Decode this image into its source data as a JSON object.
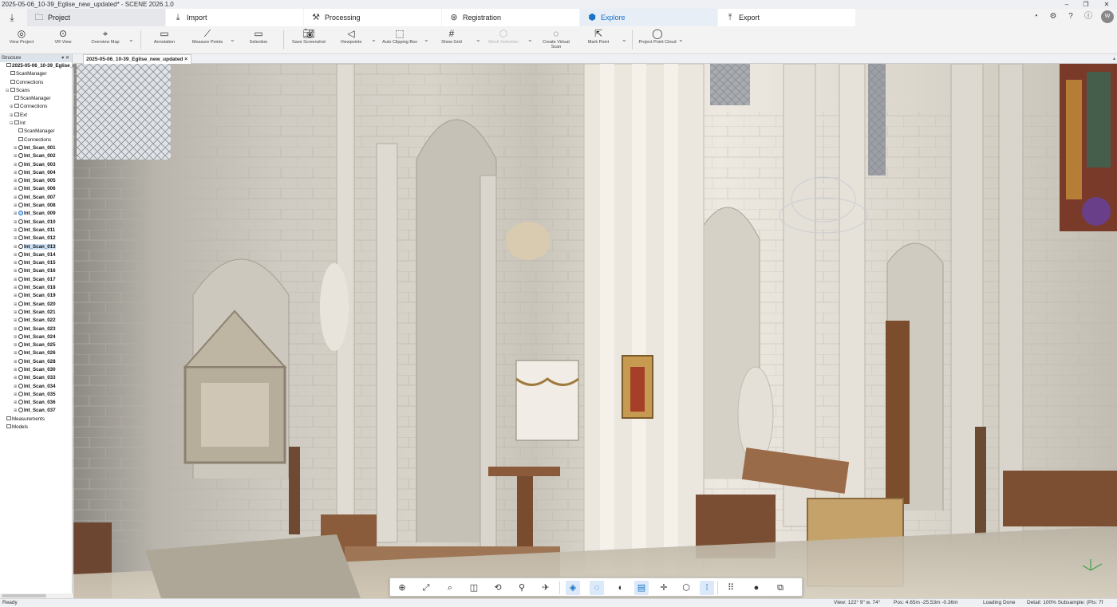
{
  "app": {
    "title": "2025-05-06_10-39_Eglise_new_updated* - SCENE 2026.1.0"
  },
  "window_controls": [
    "–",
    "❐",
    "✕"
  ],
  "workflow_tabs": [
    {
      "label": "Project",
      "icon": "folder-icon"
    },
    {
      "label": "Import",
      "icon": "import-icon"
    },
    {
      "label": "Processing",
      "icon": "processing-icon"
    },
    {
      "label": "Registration",
      "icon": "registration-icon"
    },
    {
      "label": "Explore",
      "icon": "explore-icon",
      "active": true
    },
    {
      "label": "Export",
      "icon": "export-icon"
    }
  ],
  "ribbon": [
    {
      "label": "View Project",
      "icon": "view-project-icon"
    },
    {
      "label": "VR View",
      "icon": "vr-view-icon"
    },
    {
      "label": "Overview Map",
      "icon": "overview-map-icon"
    },
    {
      "label": "Annotation",
      "icon": "annotation-icon"
    },
    {
      "label": "Measure Points",
      "icon": "measure-points-icon"
    },
    {
      "label": "Selection",
      "icon": "selection-icon"
    },
    {
      "label": "Save Screenshot",
      "icon": "camera-icon"
    },
    {
      "label": "Viewpoints",
      "icon": "viewpoints-icon"
    },
    {
      "label": "Auto Clipping Box",
      "icon": "clipping-box-icon"
    },
    {
      "label": "Show Grid",
      "icon": "grid-icon"
    },
    {
      "label": "Mesh Selection",
      "icon": "mesh-selection-icon",
      "disabled": true
    },
    {
      "label": "Create Virtual Scan",
      "icon": "virtual-scan-icon"
    },
    {
      "label": "Mark Point",
      "icon": "mark-point-icon"
    },
    {
      "label": "Project Point Cloud",
      "icon": "point-cloud-icon"
    }
  ],
  "structure": {
    "header": "Structure",
    "tree": [
      {
        "label": "2025-05-06_10-39_Eglise_new_updated",
        "level": 0,
        "bold": true,
        "type": "root"
      },
      {
        "label": "ScanManager",
        "level": 1,
        "type": "manager"
      },
      {
        "label": "Connections",
        "level": 1,
        "type": "folder"
      },
      {
        "label": "Scans",
        "level": 1,
        "type": "folder",
        "expand": "-"
      },
      {
        "label": "ScanManager",
        "level": 2,
        "type": "manager"
      },
      {
        "label": "Connections",
        "level": 2,
        "type": "folder",
        "expand": "+"
      },
      {
        "label": "Ext",
        "level": 2,
        "type": "folder",
        "expand": "+"
      },
      {
        "label": "Int",
        "level": 2,
        "type": "folder",
        "expand": "-"
      },
      {
        "label": "ScanManager",
        "level": 3,
        "type": "manager"
      },
      {
        "label": "Connections",
        "level": 3,
        "type": "folder"
      },
      {
        "label": "Int_Scan_001",
        "level": 3,
        "type": "scan"
      },
      {
        "label": "Int_Scan_002",
        "level": 3,
        "type": "scan"
      },
      {
        "label": "Int_Scan_003",
        "level": 3,
        "type": "scan"
      },
      {
        "label": "Int_Scan_004",
        "level": 3,
        "type": "scan"
      },
      {
        "label": "Int_Scan_005",
        "level": 3,
        "type": "scan"
      },
      {
        "label": "Int_Scan_006",
        "level": 3,
        "type": "scan"
      },
      {
        "label": "Int_Scan_007",
        "level": 3,
        "type": "scan"
      },
      {
        "label": "Int_Scan_008",
        "level": 3,
        "type": "scan"
      },
      {
        "label": "Int_Scan_009",
        "level": 3,
        "type": "scan",
        "current": true
      },
      {
        "label": "Int_Scan_010",
        "level": 3,
        "type": "scan"
      },
      {
        "label": "Int_Scan_011",
        "level": 3,
        "type": "scan"
      },
      {
        "label": "Int_Scan_012",
        "level": 3,
        "type": "scan"
      },
      {
        "label": "Int_Scan_013",
        "level": 3,
        "type": "scan",
        "selected": true
      },
      {
        "label": "Int_Scan_014",
        "level": 3,
        "type": "scan"
      },
      {
        "label": "Int_Scan_015",
        "level": 3,
        "type": "scan"
      },
      {
        "label": "Int_Scan_016",
        "level": 3,
        "type": "scan"
      },
      {
        "label": "Int_Scan_017",
        "level": 3,
        "type": "scan"
      },
      {
        "label": "Int_Scan_018",
        "level": 3,
        "type": "scan"
      },
      {
        "label": "Int_Scan_019",
        "level": 3,
        "type": "scan"
      },
      {
        "label": "Int_Scan_020",
        "level": 3,
        "type": "scan"
      },
      {
        "label": "Int_Scan_021",
        "level": 3,
        "type": "scan"
      },
      {
        "label": "Int_Scan_022",
        "level": 3,
        "type": "scan"
      },
      {
        "label": "Int_Scan_023",
        "level": 3,
        "type": "scan"
      },
      {
        "label": "Int_Scan_024",
        "level": 3,
        "type": "scan"
      },
      {
        "label": "Int_Scan_025",
        "level": 3,
        "type": "scan"
      },
      {
        "label": "Int_Scan_026",
        "level": 3,
        "type": "scan"
      },
      {
        "label": "Int_Scan_028",
        "level": 3,
        "type": "scan"
      },
      {
        "label": "Int_Scan_030",
        "level": 3,
        "type": "scan"
      },
      {
        "label": "Int_Scan_033",
        "level": 3,
        "type": "scan"
      },
      {
        "label": "Int_Scan_034",
        "level": 3,
        "type": "scan"
      },
      {
        "label": "Int_Scan_035",
        "level": 3,
        "type": "scan"
      },
      {
        "label": "Int_Scan_036",
        "level": 3,
        "type": "scan"
      },
      {
        "label": "Int_Scan_037",
        "level": 3,
        "type": "scan"
      },
      {
        "label": "Measurements",
        "level": 0,
        "type": "folder"
      },
      {
        "label": "Models",
        "level": 0,
        "type": "folder"
      }
    ]
  },
  "document_tab": {
    "label": "2025-05-06_10-39_Eglise_new_updated",
    "close": "✕"
  },
  "view_toolbar": [
    {
      "name": "navigation-mode-icon",
      "glyph": "⊕"
    },
    {
      "name": "zoom-extents-icon",
      "glyph": "⤢"
    },
    {
      "name": "zoom-icon",
      "glyph": "⌕"
    },
    {
      "name": "view-cube-icon",
      "glyph": "◫"
    },
    {
      "name": "rotate-view-icon",
      "glyph": "⟲"
    },
    {
      "name": "walk-mode-icon",
      "glyph": "⚲"
    },
    {
      "name": "fly-mode-icon",
      "glyph": "✈"
    },
    {
      "name": "3d-view-icon",
      "glyph": "◈",
      "on": true
    },
    {
      "name": "orbit-icon",
      "glyph": "◌",
      "on": true
    },
    {
      "name": "split-view-icon",
      "glyph": "◐"
    },
    {
      "name": "layer-icon",
      "glyph": "▤",
      "on": true
    },
    {
      "name": "crosshair-icon",
      "glyph": "✛"
    },
    {
      "name": "box-icon",
      "glyph": "⬡"
    },
    {
      "name": "point-density-icon",
      "glyph": "⁞",
      "on": true
    },
    {
      "name": "point-grid-icon",
      "glyph": "⠿"
    },
    {
      "name": "color-mode-icon",
      "glyph": "●"
    },
    {
      "name": "shapes-icon",
      "glyph": "⧉"
    }
  ],
  "status": {
    "left": "Ready",
    "view": "View: 122° 9\" w. 74°",
    "pos": "Pos: 4.65m -25.53m -0.36m",
    "loading": "Loading Done",
    "detail": "Detail: 100%  Subsample: (Pts:  7f"
  },
  "colors": {
    "accent": "#1a73c8",
    "selection": "#cde3f7"
  }
}
